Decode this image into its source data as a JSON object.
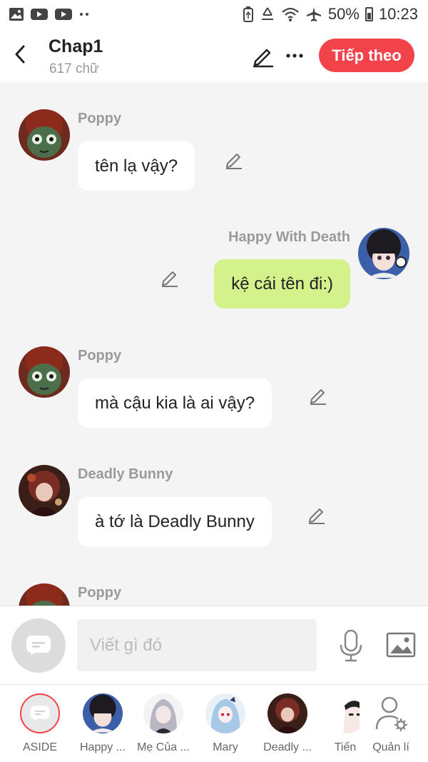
{
  "status_bar": {
    "battery": "50%",
    "time": "10:23"
  },
  "header": {
    "title": "Chap1",
    "subtitle": "617 chữ",
    "next_label": "Tiếp theo"
  },
  "messages": [
    {
      "sender": "Poppy",
      "text": "tên lạ vậy?",
      "side": "left",
      "avatar": "poppy-avatar"
    },
    {
      "sender": "Happy With Death",
      "text": "kệ cái tên đi:)",
      "side": "right",
      "avatar": "happy-avatar"
    },
    {
      "sender": "Poppy",
      "text": "mà cậu kia là ai vậy?",
      "side": "left",
      "avatar": "poppy-avatar"
    },
    {
      "sender": "Deadly Bunny",
      "text": "à tớ là Deadly Bunny",
      "side": "left",
      "avatar": "bunny-avatar"
    },
    {
      "sender": "Poppy",
      "text": "",
      "side": "left",
      "avatar": "poppy-avatar"
    }
  ],
  "composer": {
    "placeholder": "Viết gì đó"
  },
  "characters": [
    {
      "label": "ASIDE"
    },
    {
      "label": "Happy ..."
    },
    {
      "label": "Mẹ Của ..."
    },
    {
      "label": "Mary"
    },
    {
      "label": "Deadly ..."
    },
    {
      "label": "Tiến"
    },
    {
      "label": "Quản lí"
    }
  ],
  "colors": {
    "accent": "#f2434a",
    "outgoing_bubble": "#d4f28c",
    "incoming_bubble": "#ffffff",
    "background": "#f4f4f4"
  }
}
